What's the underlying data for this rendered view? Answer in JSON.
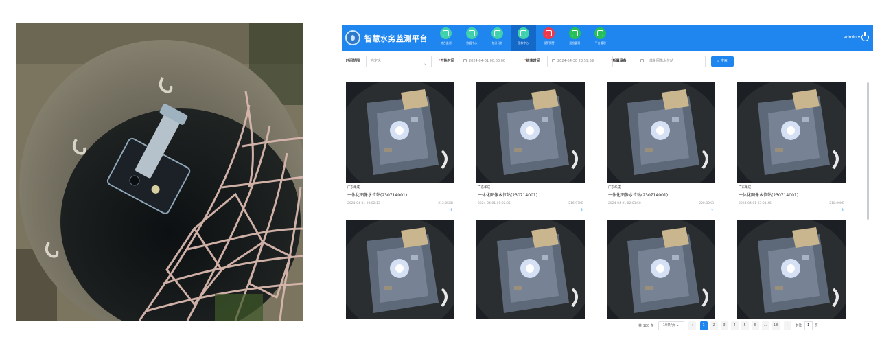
{
  "photo": {
    "icon": "manhole-camera-photo"
  },
  "app": {
    "title": "智慧水务监测平台",
    "nav": [
      {
        "label": "综合监测",
        "icon": "monitor-icon",
        "color": "#3fd0ad",
        "active": false
      },
      {
        "label": "数据中心",
        "icon": "data-icon",
        "color": "#3fd0ad",
        "active": false
      },
      {
        "label": "统计分析",
        "icon": "chart-icon",
        "color": "#3fd0ad",
        "active": false
      },
      {
        "label": "图像中心",
        "icon": "image-icon",
        "color": "#3fd0ad",
        "active": true
      },
      {
        "label": "报警预警",
        "icon": "alarm-icon",
        "color": "#f0384a",
        "active": false
      },
      {
        "label": "巡检管理",
        "icon": "inspect-icon",
        "color": "#25c05a",
        "active": false
      },
      {
        "label": "平台管理",
        "icon": "settings-icon",
        "color": "#25c05a",
        "active": false
      }
    ],
    "user": "admin"
  },
  "filters": {
    "time_range_label": "时间范围",
    "time_range_value": "自定义",
    "start_label": "开始时间",
    "start_value": "2024-04-01 00:00:00",
    "end_label": "结束时间",
    "end_value": "2024-04-30 23:59:59",
    "device_label": "所属设备",
    "device_value": "一体化图像水位站",
    "search_label": "搜索"
  },
  "cards": [
    {
      "site": "广东华成",
      "name": "一体化图像水位站(230714001)",
      "date": "2024-04-01 00:02:13",
      "size": "213.05KB"
    },
    {
      "site": "广东华成",
      "name": "一体化图像水位站(230714001)",
      "date": "2024-04-01 01:02:35",
      "size": "216.97KB"
    },
    {
      "site": "广东华成",
      "name": "一体化图像水位站(230714001)",
      "date": "2024-04-01 02:01:50",
      "size": "220.80KB"
    },
    {
      "site": "广东华成",
      "name": "一体化图像水位站(230714001)",
      "date": "2024-04-01 03:01:46",
      "size": "218.09KB"
    },
    {
      "site": "",
      "name": "",
      "date": "",
      "size": ""
    },
    {
      "site": "",
      "name": "",
      "date": "",
      "size": ""
    },
    {
      "site": "",
      "name": "",
      "date": "",
      "size": ""
    },
    {
      "site": "",
      "name": "",
      "date": "",
      "size": ""
    }
  ],
  "pagination": {
    "total": "共 180 条",
    "page_size": "10条/页",
    "pages": [
      "1",
      "2",
      "3",
      "4",
      "5",
      "6",
      "...",
      "18"
    ],
    "current": "1",
    "goto_label": "前往",
    "goto_value": "1",
    "goto_suffix": "页"
  }
}
